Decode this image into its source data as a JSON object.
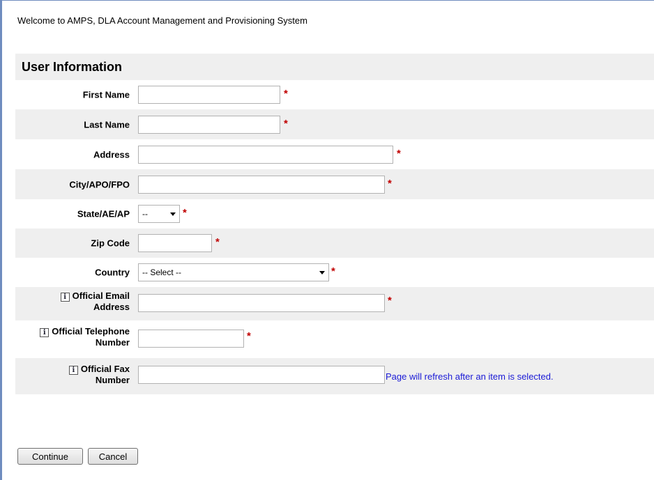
{
  "header": {
    "welcome": "Welcome to AMPS, DLA Account Management and Provisioning System"
  },
  "section": {
    "title": "User Information"
  },
  "required_marker": "*",
  "fields": {
    "first_name": {
      "label": "First Name",
      "value": ""
    },
    "last_name": {
      "label": "Last Name",
      "value": ""
    },
    "address": {
      "label": "Address",
      "value": ""
    },
    "city": {
      "label": "City/APO/FPO",
      "value": ""
    },
    "state": {
      "label": "State/AE/AP",
      "selected": "--"
    },
    "zip": {
      "label": "Zip Code",
      "value": ""
    },
    "country": {
      "label": "Country",
      "selected": "-- Select --"
    },
    "email": {
      "label_line1": "Official Email",
      "label_line2": "Address",
      "value": ""
    },
    "telephone": {
      "label_line1": "Official Telephone",
      "label_line2": "Number",
      "value": ""
    },
    "fax": {
      "label_line1": "Official Fax",
      "label_line2": "Number",
      "value": ""
    }
  },
  "info_icon_glyph": "i",
  "refresh_note": "Page will refresh after an item is selected.",
  "buttons": {
    "continue": "Continue",
    "cancel": "Cancel"
  },
  "colors": {
    "required": "#c00000",
    "note": "#1a1ad6",
    "row_shade": "#efefef",
    "frame": "#6f8cbf"
  }
}
